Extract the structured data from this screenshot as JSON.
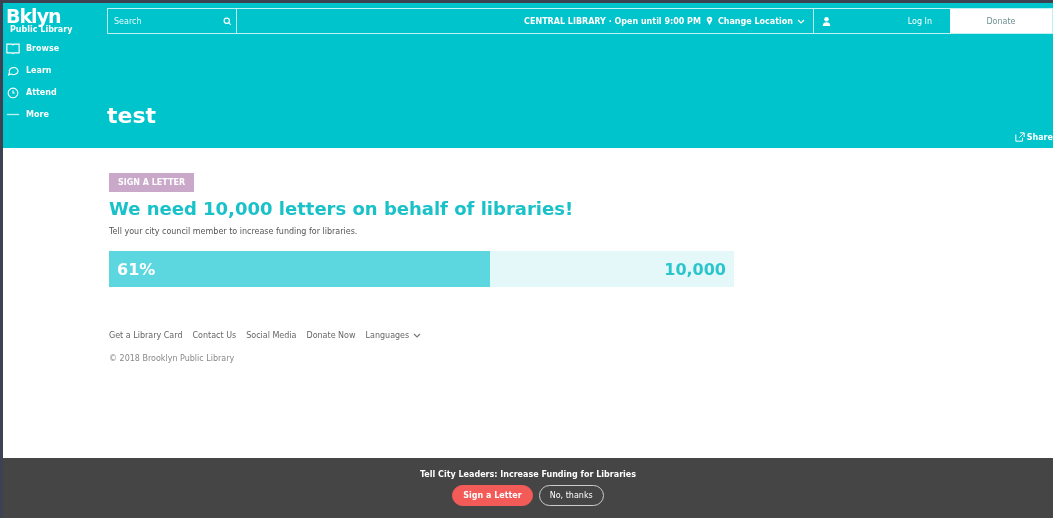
{
  "logo": {
    "title": "Bklyn",
    "subtitle": "Public Library"
  },
  "search": {
    "placeholder": "Search"
  },
  "top_bar": {
    "location": "CENTRAL LIBRARY · Open until 9:00 PM",
    "branch": "Change Location",
    "login": "Log In",
    "donate": "Donate"
  },
  "sidebar": {
    "items": [
      {
        "label": "Browse",
        "kind": "book"
      },
      {
        "label": "Learn",
        "kind": "chat"
      },
      {
        "label": "Attend",
        "kind": "clock"
      },
      {
        "label": "More",
        "kind": "dots"
      }
    ]
  },
  "page_title": "test",
  "share": "Share",
  "campaign": {
    "badge": "SIGN A LETTER",
    "heading": "We need 10,000 letters on behalf of libraries!",
    "subtext": "Tell your city council member to increase funding for libraries.",
    "progress": {
      "level": 0.61,
      "percent": "61%",
      "goal": "10,000"
    }
  },
  "footer": {
    "links": [
      {
        "label": "Get a Library Card",
        "kind": "link"
      },
      {
        "label": "Contact Us",
        "kind": "link"
      },
      {
        "label": "Social Media",
        "kind": "link"
      },
      {
        "label": "Donate Now",
        "kind": "link"
      },
      {
        "label": "Languages",
        "kind": "dropdown"
      }
    ],
    "copyright": "© 2018 Brooklyn Public Library"
  },
  "banner": {
    "text": "Tell City Leaders: Increase Funding for Libraries",
    "primary": "Sign a Letter",
    "secondary": "No, thanks"
  }
}
